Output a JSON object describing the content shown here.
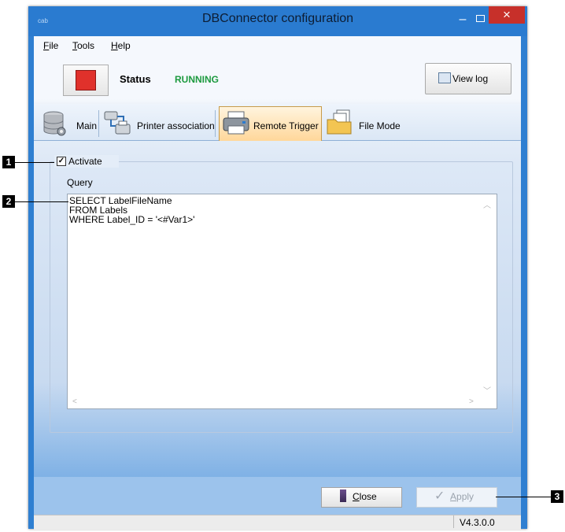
{
  "window": {
    "logo": "cab",
    "title": "DBConnector configuration",
    "minimize_glyph": "–",
    "close_glyph": "×"
  },
  "menu": {
    "items": [
      {
        "underline": "F",
        "rest": "ile"
      },
      {
        "underline": "T",
        "rest": "ools"
      },
      {
        "underline": "H",
        "rest": "elp"
      }
    ]
  },
  "status": {
    "label": "Status",
    "value": "RUNNING",
    "value_color": "#1d9a3f",
    "stop_icon": "stop-icon",
    "view_log_label": "View log"
  },
  "tabs": [
    {
      "label": "Main",
      "icon": "database-gear-icon",
      "active": false
    },
    {
      "label": "Printer association",
      "icon": "printer-link-icon",
      "active": false
    },
    {
      "label": "Remote Trigger",
      "icon": "printer-icon",
      "active": true
    },
    {
      "label": "File Mode",
      "icon": "folder-files-icon",
      "active": false
    }
  ],
  "remote_trigger": {
    "activate_label": "Activate",
    "activate_checked": true,
    "query_label": "Query",
    "query_value": "SELECT LabelFileName\nFROM Labels\nWHERE Label_ID = '<#Var1>'"
  },
  "buttons": {
    "close_mnemonic": "C",
    "close_rest": "lose",
    "apply_mnemonic": "A",
    "apply_rest": "pply",
    "apply_enabled": false
  },
  "statusbar": {
    "version": "V4.3.0.0"
  },
  "callouts": [
    "1",
    "2",
    "3"
  ],
  "colors": {
    "titlebar": "#2a7bd0",
    "close_button": "#c7302a",
    "stop_button": "#e0312b",
    "active_tab": "#ffd79a"
  }
}
